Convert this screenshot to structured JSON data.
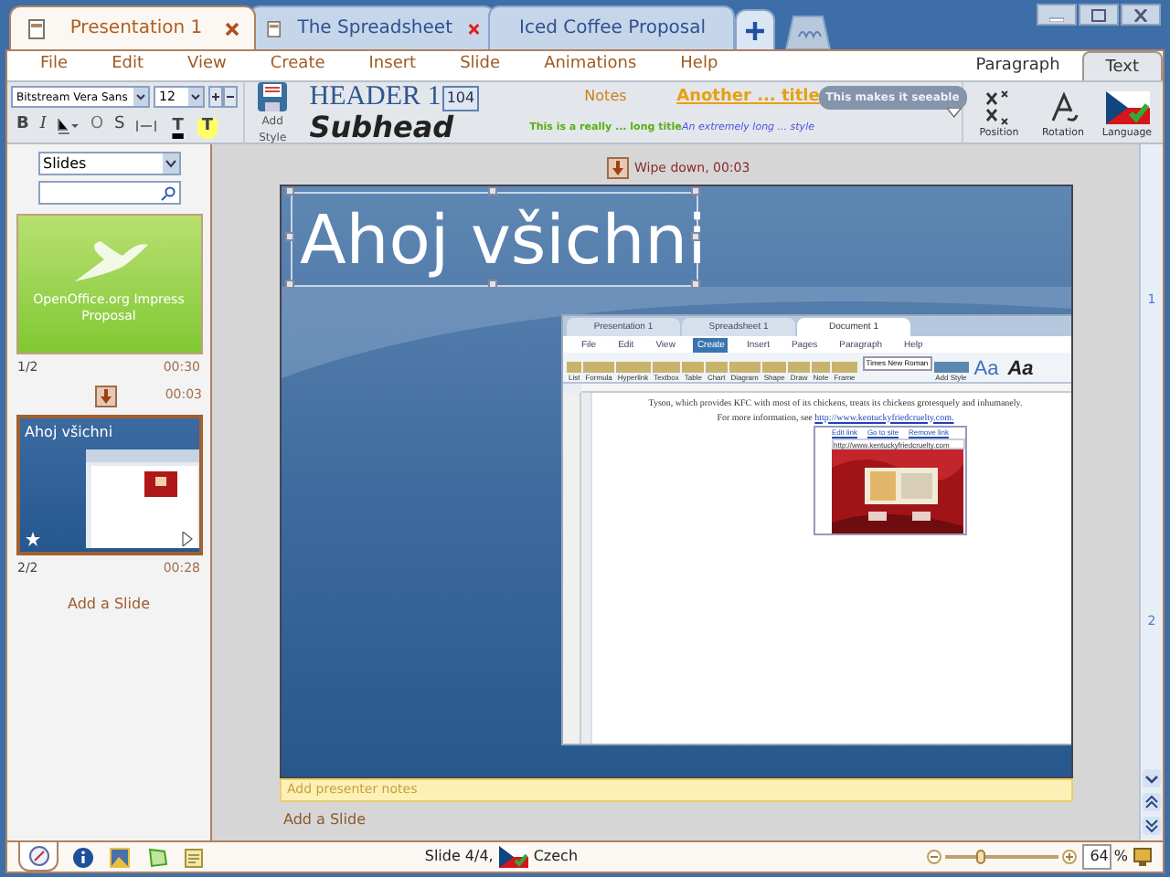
{
  "document_tabs": [
    {
      "title": "Presentation 1",
      "selected": true
    },
    {
      "title": "The Spreadsheet",
      "selected": false
    },
    {
      "title": "Iced Coffee Proposal",
      "selected": false
    }
  ],
  "menu": [
    "File",
    "Edit",
    "View",
    "Create",
    "Insert",
    "Slide",
    "Animations",
    "Help"
  ],
  "ribbon_tabs": [
    {
      "label": "Paragraph",
      "selected": false
    },
    {
      "label": "Text",
      "selected": true
    }
  ],
  "font": {
    "family": "Bitstream Vera Sans",
    "size": "12"
  },
  "format_buttons": [
    "B",
    "I",
    "O",
    "S"
  ],
  "color_buttons": [
    {
      "label": "T",
      "color": "#000000"
    },
    {
      "label": "T",
      "color": "#ffff66"
    }
  ],
  "add_style": "Add Style",
  "styles": [
    {
      "kind": "header",
      "label": "HEADER 1",
      "badge": "104"
    },
    {
      "kind": "notes",
      "label": "Notes"
    },
    {
      "kind": "title",
      "label": "Another ... title"
    },
    {
      "kind": "glow",
      "label": "This makes it seeable"
    },
    {
      "kind": "subhead",
      "label": "Subhead"
    },
    {
      "kind": "green",
      "label": "This is a really ... long title"
    },
    {
      "kind": "small",
      "label": "An extremely long ... style"
    }
  ],
  "text_tools": [
    "Position",
    "Rotation",
    "Language"
  ],
  "sidebar": {
    "view": "Slides",
    "slides": [
      {
        "kind": "logo",
        "caption": "OpenOffice.org Impress Proposal",
        "number": "1/2",
        "time": "00:30",
        "selected": false,
        "transition": "00:03"
      },
      {
        "kind": "screenshot",
        "caption": "Ahoj všichni",
        "number": "2/2",
        "time": "00:28",
        "selected": true
      }
    ],
    "add_slide": "Add a Slide"
  },
  "editor": {
    "transition": "Wipe down, 00:03",
    "slide_title": "Ahoj všichni",
    "notes_placeholder": "Add presenter notes",
    "add_slide": "Add a Slide",
    "page_numbers": [
      "1",
      "2"
    ]
  },
  "embedded_window": {
    "tabs": [
      {
        "title": "Presentation 1",
        "selected": false
      },
      {
        "title": "Spreadsheet 1",
        "selected": false
      },
      {
        "title": "Document 1",
        "selected": true
      }
    ],
    "menu": [
      {
        "label": "File",
        "selected": false
      },
      {
        "label": "Edit",
        "selected": false
      },
      {
        "label": "View",
        "selected": false
      },
      {
        "label": "Create",
        "selected": true
      },
      {
        "label": "Insert",
        "selected": false
      },
      {
        "label": "Pages",
        "selected": false
      },
      {
        "label": "Paragraph",
        "selected": false
      },
      {
        "label": "Help",
        "selected": false
      }
    ],
    "tools": [
      "List",
      "Formula",
      "Hyperlink",
      "Textbox",
      "Table",
      "Chart",
      "Diagram",
      "Shape",
      "Draw",
      "Note",
      "Frame"
    ],
    "font": "Times New Roman",
    "add_style": "Add Style",
    "style_samples": [
      "Aa",
      "Aa"
    ],
    "text": "Tyson, which provides KFC with most of its chickens, treats its chickens grotesquely and inhumanely.",
    "text_prefix": "For more information, see ",
    "link": "http://www.kentuckyfriedcruelty.com.",
    "popup": {
      "actions": [
        "Edit link",
        "Go to site",
        "Remove link"
      ],
      "url": "http://www.kentuckyfriedcruelty.com"
    }
  },
  "status": {
    "slide": "Slide 4/4,",
    "language": "Czech",
    "zoom": {
      "value": "64",
      "unit": "%",
      "level": 0.3
    }
  }
}
